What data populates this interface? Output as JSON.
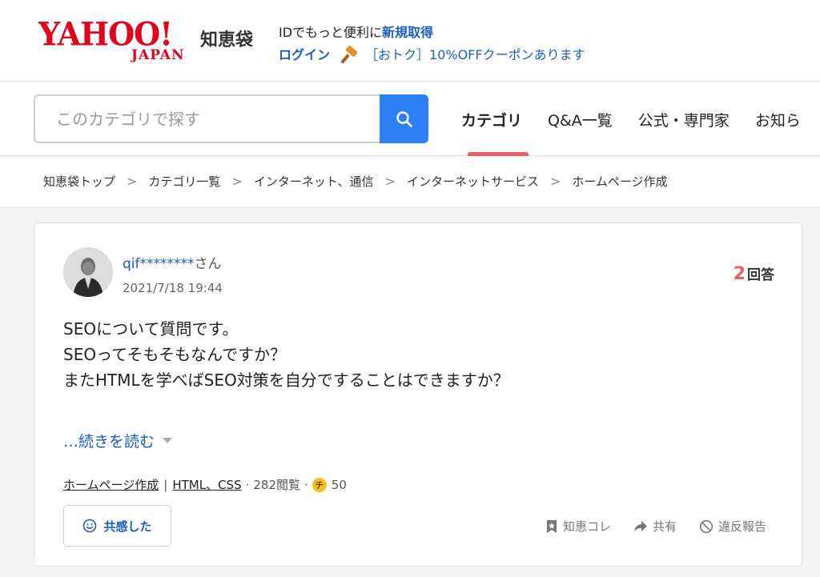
{
  "header": {
    "logo_yahoo": "YAHOO!",
    "logo_japan": "JAPAN",
    "logo_service": "知恵袋",
    "info_text": "IDでもっと便利に",
    "new_account_link": "新規取得",
    "login_link": "ログイン",
    "coupon_link": "［おトク］10%OFFクーポンあります"
  },
  "search": {
    "placeholder": "このカテゴリで探す"
  },
  "tabs": [
    {
      "label": "カテゴリ",
      "active": true
    },
    {
      "label": "Q&A一覧",
      "active": false
    },
    {
      "label": "公式・専門家",
      "active": false
    },
    {
      "label": "お知ら",
      "active": false
    }
  ],
  "breadcrumb": [
    "知恵袋トップ",
    "カテゴリ一覧",
    "インターネット、通信",
    "インターネットサービス",
    "ホームページ作成"
  ],
  "breadcrumb_separator": ">",
  "question": {
    "user_name": "qif********",
    "user_suffix": "さん",
    "date": "2021/7/18 19:44",
    "answer_count": "2",
    "answer_label": "回答",
    "lines": [
      "SEOについて質問です。",
      "SEOってそもそもなんですか？",
      "またHTMLを学べばSEO対策を自分ですることはできますか？"
    ],
    "read_more": "…続きを読む",
    "categories": [
      "ホームページ作成",
      "HTML、CSS"
    ],
    "views": "282閲覧",
    "coin_symbol": "チ",
    "coins": "50",
    "empathy_button": "共感した",
    "actions": {
      "bookmark": "知恵コレ",
      "share": "共有",
      "report": "違反報告"
    }
  },
  "colors": {
    "brand_red": "#e2001a",
    "link_blue": "#1a5dc2",
    "search_button": "#2f7ff4",
    "tab_indicator": "#e86066"
  }
}
